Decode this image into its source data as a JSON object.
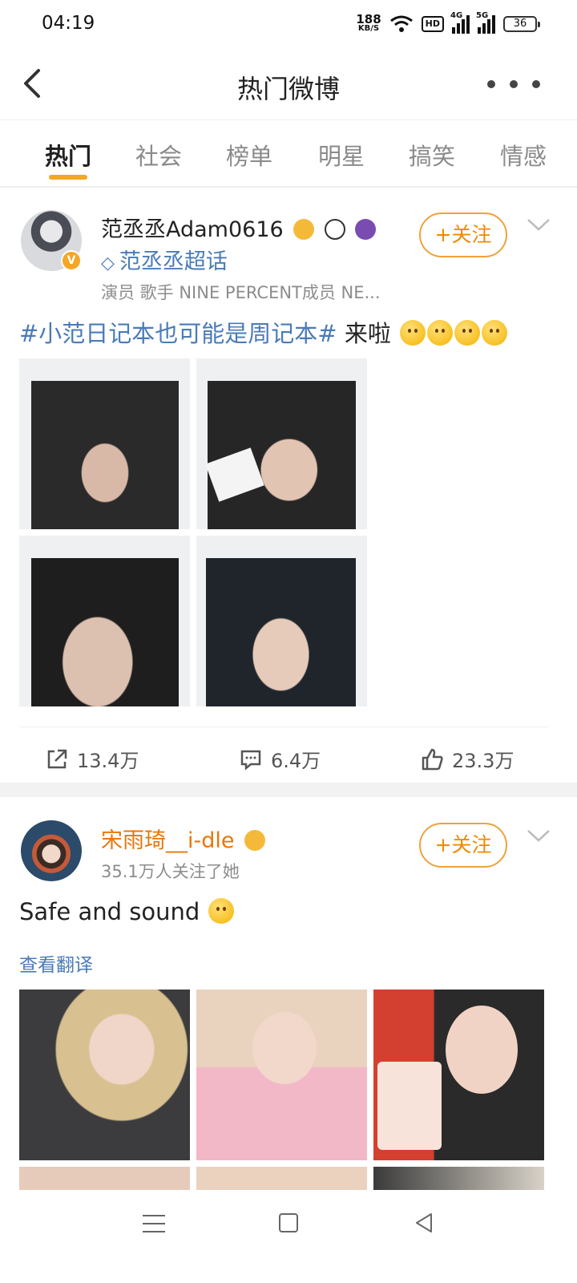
{
  "status": {
    "time": "04:19",
    "speed_value": "188",
    "speed_unit": "KB/S",
    "hd": "HD",
    "net1": "4G",
    "net2": "5G",
    "battery": "36"
  },
  "header": {
    "title": "热门微博"
  },
  "tabs": [
    "热门",
    "社会",
    "榜单",
    "明星",
    "搞笑",
    "情感"
  ],
  "posts": [
    {
      "name": "范丞丞Adam0616",
      "supertopic": "范丞丞超话",
      "bio": "演员 歌手 NINE PERCENT成员 NE...",
      "follow_label": "+关注",
      "topic": "#小范日记本也可能是周记本#",
      "text": " 来啦",
      "reposts": "13.4万",
      "comments": "6.4万",
      "likes": "23.3万"
    },
    {
      "name": "宋雨琦__i-dle",
      "meta": "35.1万人关注了她",
      "follow_label": "+关注",
      "text": "Safe and sound",
      "translate": "查看翻译"
    }
  ],
  "colors": {
    "accent": "#f5a623",
    "link": "#4a7bb7",
    "follow": "#f08a00"
  }
}
